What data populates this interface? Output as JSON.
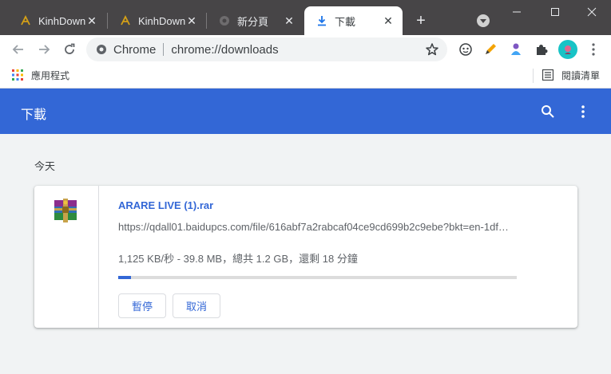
{
  "tabs": [
    {
      "title": "KinhDown",
      "active": false,
      "icon": "kinhdown-icon"
    },
    {
      "title": "KinhDown",
      "active": false,
      "icon": "kinhdown-icon"
    },
    {
      "title": "新分頁",
      "active": false,
      "icon": "chrome-icon"
    },
    {
      "title": "下載",
      "active": true,
      "icon": "download-icon"
    }
  ],
  "omnibox": {
    "chip": "Chrome",
    "url": "chrome://downloads"
  },
  "bookmarks": {
    "apps_label": "應用程式",
    "reading_list_label": "閱讀清單"
  },
  "page": {
    "title": "下載",
    "date_label": "今天"
  },
  "download": {
    "file_name": "ARARE LIVE (1).rar",
    "url": "https://qdall01.baidupcs.com/file/616abf7a2rabcaf04ce9cd699b2c9ebe?bkt=en-1df…",
    "status": "1,125 KB/秒 - 39.8 MB，總共 1.2 GB，還剩 18 分鐘",
    "progress_fraction": 0.032,
    "pause_label": "暫停",
    "cancel_label": "取消"
  },
  "colors": {
    "accent": "#3367d6",
    "tabstrip": "#474547",
    "page_bg": "#f1f3f4"
  }
}
